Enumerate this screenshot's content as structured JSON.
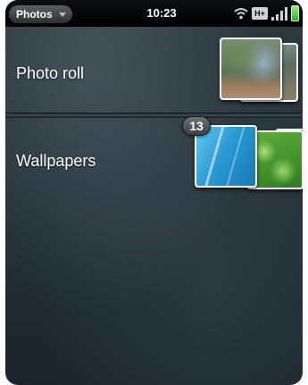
{
  "status_bar": {
    "app_menu_label": "Photos",
    "time": "10:23",
    "network_label": "H+",
    "icons": [
      "chevron-down-icon",
      "wifi-icon",
      "signal-icon",
      "battery-icon"
    ]
  },
  "albums": [
    {
      "label": "Photo roll"
    },
    {
      "label": "Wallpapers",
      "count": "13"
    }
  ],
  "colors": {
    "accent_blue": "#2a9ad4",
    "battery_green": "#28b31c",
    "background": "#26323a"
  }
}
